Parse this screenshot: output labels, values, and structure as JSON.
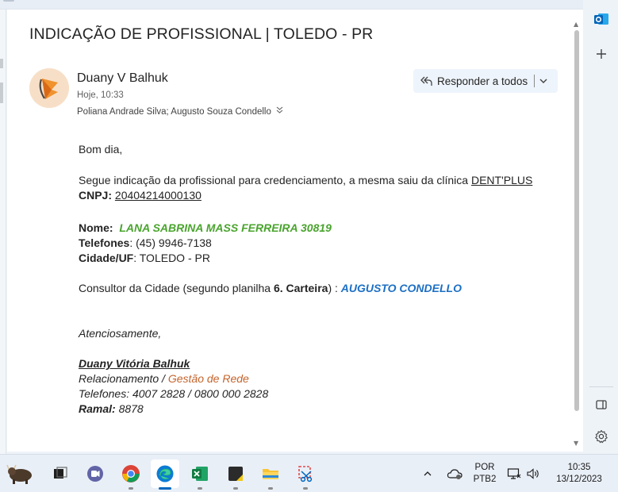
{
  "email": {
    "subject": "INDICAÇÃO DE PROFISSIONAL | TOLEDO - PR",
    "sender_name": "Duany V Balhuk",
    "sent_time": "Hoje, 10:33",
    "recipients": "Poliana Andrade Silva; Augusto Souza Condello",
    "reply_all_label": "Responder a todos"
  },
  "body": {
    "greeting": "Bom dia,",
    "intro_text": "Segue indicação da profissional para credenciamento, a mesma saiu da clínica ",
    "clinic_link": "DENT'PLUS",
    "cnpj_label": "CNPJ:",
    "cnpj_value": "20404214000130",
    "name_label": "Nome:",
    "name_value": "LANA SABRINA MASS FERREIRA 30819",
    "phones_label": "Telefones",
    "phones_value": ": (45) 9946-7138",
    "city_label": "Cidade/UF",
    "city_value": ": TOLEDO - PR",
    "consultant_text": "Consultor da Cidade (segundo planilha ",
    "consultant_sheet": "6. Carteira",
    "consultant_close": ") : ",
    "consultant_name": "AUGUSTO CONDELLO",
    "closing": "Atenciosamente,",
    "sig_name": "Duany Vitória Balhuk",
    "sig_role": "Relacionamento / ",
    "sig_dept": "Gestão de Rede",
    "sig_phones": "Telefones: 4007 2828 / 0800 000 2828",
    "sig_ramal_label": "Ramal:",
    "sig_ramal_value": " 8878"
  },
  "taskbar": {
    "language_top": "POR",
    "language_bottom": "PTB2",
    "clock_time": "10:35",
    "clock_date": "13/12/2023"
  },
  "icons": {
    "outlook": "outlook-icon",
    "add": "add-icon",
    "panel": "side-panel-icon",
    "settings": "gear-icon"
  },
  "colors": {
    "accent": "#0078d4",
    "green_name": "#4aa42e",
    "blue_consultant": "#1c6fc4",
    "orange_dept": "#c5632b"
  }
}
